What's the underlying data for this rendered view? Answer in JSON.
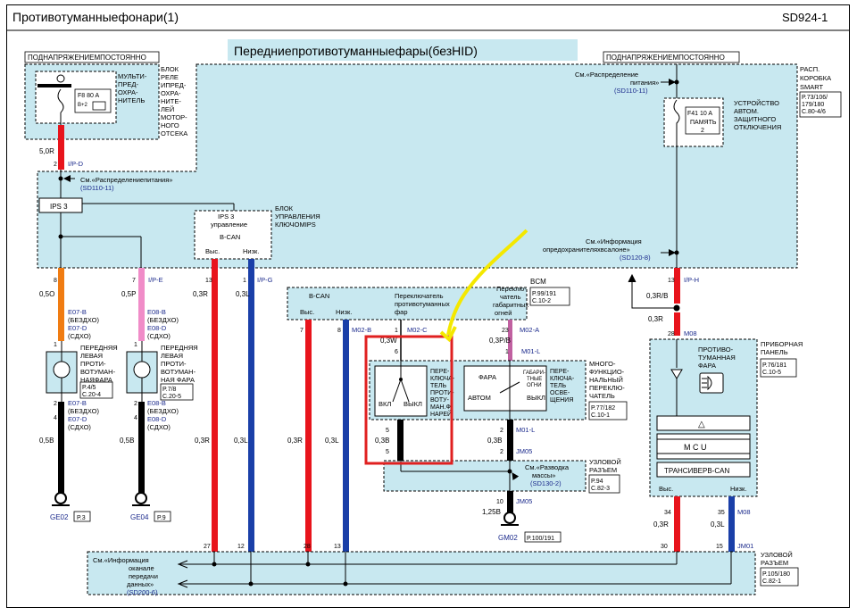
{
  "header": {
    "title": "Противотуманныефонари(1)",
    "code": "SD924-1"
  },
  "banner": "Передниепротивотуманныефары(безHID)",
  "power_labels": {
    "left": "ПОДНАПРЯЖЕНИЕМПОСТОЯННО",
    "right": "ПОДНАПРЯЖЕНИЕМПОСТОЯННО"
  },
  "relay": {
    "name_lines": [
      "МУЛЬТИ-",
      "ПРЕД-",
      "ОХРА-",
      "НИТЕЛЬ"
    ],
    "block_lines": [
      "БЛОК",
      "РЕЛЕ",
      "ИПРЕД-",
      "ОХРА-",
      "НИТЕ-",
      "ЛЕЙ",
      "МОТОР-",
      "НОГО",
      "ОТСЕКА"
    ],
    "fuse": "F8 80 A",
    "fuse_sub": "B+2"
  },
  "smart": {
    "see_dist": [
      "См.«Распределение",
      "питания»"
    ],
    "see_dist_ref": "(SD110-11)",
    "fuse": "F41 10 A",
    "fuse_sub": [
      "ПАМЯТЬ",
      "2"
    ],
    "device_lines": [
      "УСТРОЙСТВО",
      "АВТОМ.",
      "ЗАЩИТНОГО",
      "ОТКЛЮЧЕНИЯ"
    ],
    "box_lines": [
      "РАСП.",
      "КОРОБКА",
      "SMART"
    ],
    "box_ref": [
      "P.73/106/",
      "179/180",
      "C.80-4/6"
    ],
    "see_info": [
      "См.«Информация",
      "опредохранителяхвсалоне»"
    ],
    "see_info_ref": "(SD120-8)"
  },
  "ips": {
    "see": "См.«Распределениепитания»",
    "see_ref": "(SD110-11)",
    "ips3": "IPS 3",
    "ctrl": [
      "IPS 3",
      "управление"
    ],
    "bcan": "B-CAN",
    "high": "Выс.",
    "low": "Низк.",
    "block_lines": [
      "БЛОК",
      "УПРАВЛЕНИЯ",
      "КЛЮЧОМIPS"
    ]
  },
  "wire_labels": {
    "w50r": "5,0R",
    "p2": "2",
    "ip_d": "I/P-D",
    "p8": "8",
    "w05o": "0,5O",
    "p7": "7",
    "ip_e": "I/P-E",
    "w05p": "0,5P",
    "p13": "13",
    "p1": "1",
    "ip_g": "I/P-G",
    "w03r": "0,3R",
    "w03l": "0,3L",
    "p13b": "13",
    "ip_h": "I/P-H",
    "w03rb": "0,3R/B",
    "p28": "28",
    "m08": "M08",
    "w03r2": "0,3R",
    "w03l2": "0,3L",
    "p34": "34",
    "p35": "35",
    "m08b": "M08",
    "w03r3": "0,3R",
    "w03l3": "0,3L",
    "p30": "30",
    "p15": "15",
    "jm01": "JM01",
    "p27": "27",
    "p12": "12",
    "p28b": "28",
    "p13c": "13"
  },
  "lamps": {
    "left": {
      "conn_top": [
        "E07-B",
        "(БЕЗДХО)",
        "E07-D",
        "(СДХО)"
      ],
      "p1": "1",
      "name": [
        "ПЕРЕДНЯЯ",
        "ЛЕВАЯ",
        "ПРОТИ-",
        "ВОТУМАН-",
        "НАЯФАРА"
      ],
      "ref": [
        "P.4/5",
        "C.20-4"
      ],
      "p2": "2",
      "p4": "4",
      "conn_bot": [
        "E07-B",
        "(БЕЗДХО)",
        "E07-D",
        "(СДХО)"
      ],
      "wire": "0,5B",
      "ground": "GE02",
      "ground_ref": "P.3"
    },
    "right": {
      "conn_top": [
        "E08-B",
        "(БЕЗДХО)",
        "E08-D",
        "(СДХО)"
      ],
      "p1": "1",
      "name": [
        "ПЕРЕДНЯЯ",
        "ЛЕВАЯ",
        "ПРОТИ-",
        "ВОТУМАН-",
        "НАЯФАРА"
      ],
      "name2": [
        "ПЕРЕДНЯЯ",
        "ЛЕВАЯ",
        "ПРОТИ-",
        "ВОТУМАН-",
        "НАЯ ФАРА"
      ],
      "ref": [
        "P.7/8",
        "C.20-5"
      ],
      "p2": "2",
      "p4": "4",
      "conn_bot": [
        "E08-B",
        "(БЕЗДХО)",
        "E08-D",
        "(СДХО)"
      ],
      "wire": "0,5B",
      "ground": "GE04",
      "ground_ref": "P.9"
    }
  },
  "bcm": {
    "bcan": "B-CAN",
    "high": "Выс.",
    "low": "Низк.",
    "fog_switch": [
      "Переключатель",
      "противотуманных",
      "фар"
    ],
    "lamp_switch": [
      "Переклю-",
      "чатель",
      "габаритных",
      "огней"
    ],
    "label": "BCM",
    "ref": [
      "P.99/191",
      "C.10-2"
    ],
    "p7": "7",
    "p8": "8",
    "m02b": "M02-B",
    "p1": "1",
    "m02c": "M02-C",
    "w03w": "0,3W",
    "p6": "6",
    "p23": "23",
    "m02a": "M02-A",
    "w03pb": "0,3P/B",
    "p1b": "1",
    "m01l": "M01-L"
  },
  "multifunction": {
    "fog_sw_lines": [
      "ПЕРЕ-",
      "КЛЮЧА-",
      "ТЕЛЬ",
      "ПРОТИ-",
      "ВОТУ-",
      "МАН.Ф-",
      "НАРЕЙ"
    ],
    "on": "ВКЛ",
    "off": "ВЫКЛ",
    "head": "ФАРА",
    "dims": [
      "ГАБАРИ-",
      "ТНЫЕ",
      "ОГНИ"
    ],
    "auto": "АВТОМ",
    "off2": "ВЫКЛ",
    "light_sw_lines": [
      "ПЕРЕ-",
      "КЛЮЧА-",
      "ТЕЛЬ",
      "ОСВЕ-",
      "ЩЕНИЯ"
    ],
    "name_lines": [
      "МНОГО-",
      "ФУНКЦИО-",
      "НАЛЬНЫЙ",
      "ПЕРЕКЛЮ-",
      "ЧАТЕЛЬ"
    ],
    "ref": [
      "P.77/182",
      "C.10-1"
    ],
    "p5": "5",
    "w03b": "0,3B",
    "p5b": "5",
    "p2": "2",
    "m01l": "M01-L",
    "w03b2": "0,3B",
    "p2b": "2",
    "jm05": "JM05"
  },
  "junction1": {
    "see": [
      "См.«Разводка",
      "массы»"
    ],
    "see_ref": "(SD130-2)",
    "name": [
      "УЗЛОВОЙ",
      "РАЗЪЕМ"
    ],
    "ref": [
      "P.94",
      "C.82-3"
    ],
    "p10": "10",
    "jm05": "JM05",
    "wire": "1,25B",
    "ground": "GM02",
    "ground_ref": "P.100/191"
  },
  "cluster": {
    "name": [
      "ПРИБОРНАЯ",
      "ПАНЕЛЬ"
    ],
    "ref": [
      "P.76/181",
      "C.10-5"
    ],
    "fog": [
      "ПРОТИВО-",
      "ТУМАННАЯ",
      "ФАРА"
    ],
    "triangle": "△",
    "mcu": "M C U",
    "can": "ТРАНСИВЕРВ-CAN",
    "high": "Выс.",
    "low": "Низк."
  },
  "junction2": {
    "see": [
      "См.«Информация",
      "оканале",
      "передачи",
      "данных»"
    ],
    "see_ref": "(SD200-6)",
    "name": [
      "УЗЛОВОЙ",
      "РАЗЪЕМ"
    ],
    "ref": [
      "P.105/180",
      "C.82-1"
    ]
  },
  "colors": {
    "red": "#e8141c",
    "blue": "#1a3fa8",
    "orange": "#f07c12",
    "pink": "#f08cc8",
    "violet": "#c060a0",
    "fill": "#c8e8f0",
    "highlight": "#e02020",
    "arrow": "#f4e800"
  }
}
